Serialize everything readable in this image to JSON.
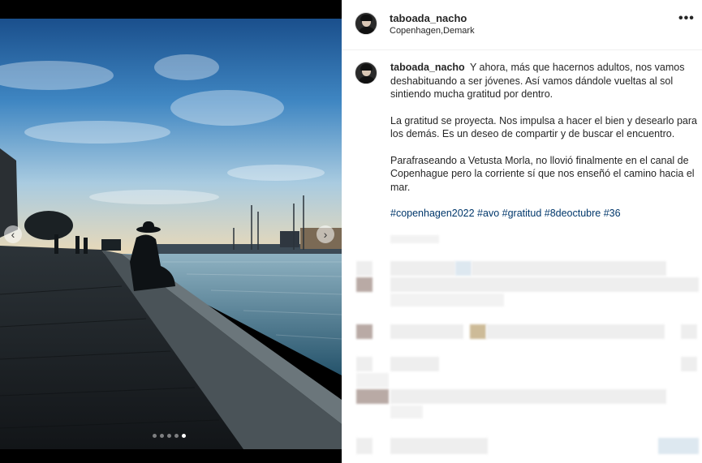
{
  "post": {
    "username": "taboada_nacho",
    "location": "Copenhagen,Demark",
    "more_label": "•••",
    "caption": {
      "username": "taboada_nacho",
      "paragraph_1": "Y ahora, más que hacernos adultos, nos vamos deshabituando a ser jóvenes. Así vamos dándole vueltas al sol sintiendo mucha gratitud por dentro.",
      "paragraph_2": "La gratitud se proyecta. Nos impulsa a hacer el bien y desearlo para los demás. Es un deseo de compartir y de buscar el encuentro.",
      "paragraph_3": "Parafraseando a Vetusta Morla, no llovió finalmente en el canal de Copenhague pero la corriente sí que nos enseñó el camino hacia el mar.",
      "hashtags": "#copenhagen2022 #avo #gratitud #8deoctubre #36"
    }
  },
  "carousel": {
    "prev_icon": "‹",
    "next_icon": "›",
    "slide_count": 5,
    "active_index": 4
  },
  "icons": {
    "prev": "chevron-left-icon",
    "next": "chevron-right-icon",
    "more": "more-horizontal-icon"
  },
  "colors": {
    "hashtag": "#00376b",
    "text": "#262626",
    "sky_top": "#1e5d9a",
    "water": "#5f8ca0"
  }
}
